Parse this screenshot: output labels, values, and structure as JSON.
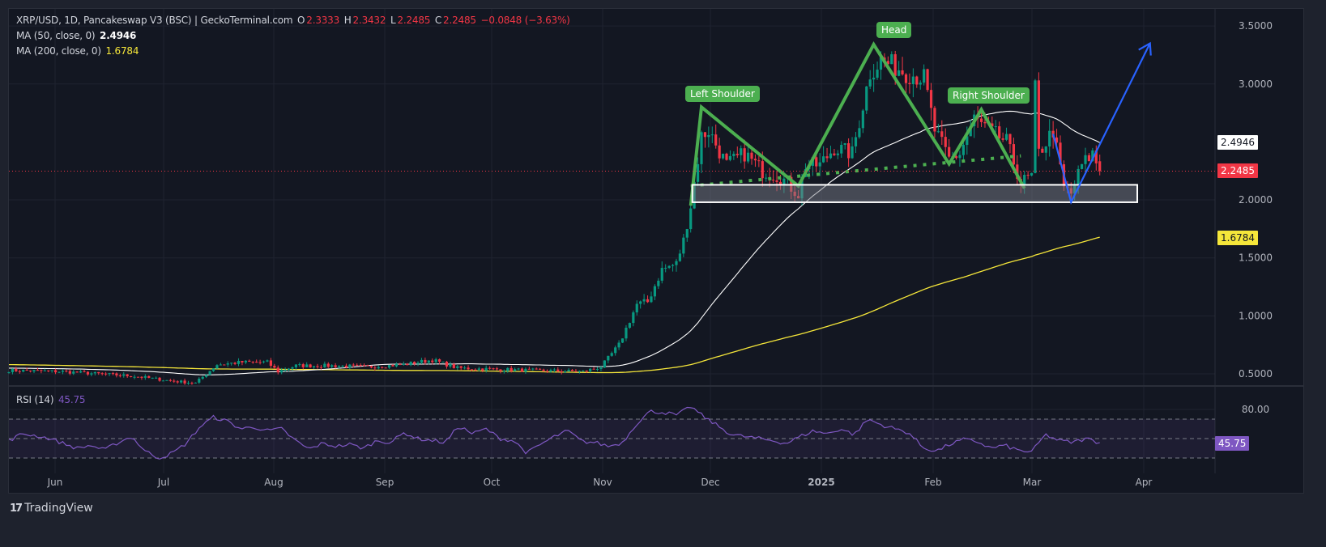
{
  "header": {
    "symbol": "XRP/USD, 1D, Pancakeswap V3 (BSC) | GeckoTerminal.com",
    "open_label": "O",
    "open": "2.3333",
    "high_label": "H",
    "high": "2.3432",
    "low_label": "L",
    "low": "2.2485",
    "close_label": "C",
    "close": "2.2485",
    "change": "−0.0848 (−3.63%)"
  },
  "indicators": {
    "ma50_label": "MA (50, close, 0)",
    "ma50_value": "2.4946",
    "ma200_label": "MA (200, close, 0)",
    "ma200_value": "1.6784",
    "rsi_label": "RSI (14)",
    "rsi_value": "45.75"
  },
  "price_badges": {
    "ma50": "2.4946",
    "last": "2.2485",
    "ma200": "1.6784",
    "rsi": "45.75"
  },
  "pattern_labels": {
    "left_shoulder": "Left Shoulder",
    "head": "Head",
    "right_shoulder": "Right Shoulder"
  },
  "footer": {
    "brand": "TradingView",
    "logo_mark": "17"
  },
  "colors": {
    "up": "#089981",
    "down": "#f23645",
    "ma50": "#ffffff",
    "ma200": "#f5e63a",
    "rsi": "#7e57c2",
    "pattern": "#4caf50",
    "projection": "#2962ff",
    "background": "#131722"
  },
  "chart_data": [
    {
      "type": "candlestick",
      "title": "XRP/USD, 1D, Pancakeswap V3 (BSC)",
      "yaxis": {
        "ticks": [
          "3.5000",
          "3.0000",
          "2.0000",
          "1.5000",
          "1.0000",
          "0.5000"
        ],
        "tick_values": [
          3.5,
          3.0,
          2.0,
          1.5,
          1.0,
          0.5
        ],
        "range": [
          0.38,
          3.7
        ],
        "scale": "linear"
      },
      "xaxis": {
        "ticks": [
          "Jun",
          "Jul",
          "Aug",
          "Sep",
          "Oct",
          "Nov",
          "Dec",
          "2025",
          "Feb",
          "Mar",
          "Apr"
        ]
      },
      "price_path": {
        "description": "approximate daily close anchors (day index from May 20, 2024)",
        "anchors": [
          [
            0,
            0.53
          ],
          [
            15,
            0.52
          ],
          [
            25,
            0.5
          ],
          [
            35,
            0.48
          ],
          [
            45,
            0.44
          ],
          [
            52,
            0.42
          ],
          [
            58,
            0.58
          ],
          [
            65,
            0.6
          ],
          [
            72,
            0.6
          ],
          [
            75,
            0.52
          ],
          [
            80,
            0.57
          ],
          [
            90,
            0.57
          ],
          [
            100,
            0.56
          ],
          [
            105,
            0.57
          ],
          [
            110,
            0.58
          ],
          [
            118,
            0.62
          ],
          [
            125,
            0.55
          ],
          [
            135,
            0.54
          ],
          [
            145,
            0.53
          ],
          [
            160,
            0.52
          ],
          [
            165,
            0.56
          ],
          [
            170,
            0.75
          ],
          [
            175,
            1.1
          ],
          [
            178,
            1.12
          ],
          [
            182,
            1.4
          ],
          [
            186,
            1.45
          ],
          [
            188,
            1.65
          ],
          [
            190,
            1.95
          ],
          [
            193,
            2.55
          ],
          [
            195,
            2.6
          ],
          [
            200,
            2.3
          ],
          [
            205,
            2.4
          ],
          [
            210,
            2.25
          ],
          [
            215,
            2.2
          ],
          [
            220,
            2.05
          ],
          [
            222,
            2.3
          ],
          [
            226,
            2.3
          ],
          [
            230,
            2.45
          ],
          [
            235,
            2.4
          ],
          [
            240,
            3.1
          ],
          [
            243,
            3.2
          ],
          [
            247,
            3.15
          ],
          [
            250,
            3.1
          ],
          [
            255,
            3.05
          ],
          [
            258,
            2.6
          ],
          [
            262,
            2.35
          ],
          [
            265,
            2.4
          ],
          [
            269,
            2.7
          ],
          [
            273,
            2.6
          ],
          [
            278,
            2.5
          ],
          [
            282,
            2.15
          ],
          [
            285,
            2.2
          ],
          [
            286,
            2.95
          ],
          [
            287,
            2.4
          ],
          [
            291,
            2.6
          ],
          [
            294,
            2.1
          ],
          [
            296,
            2.05
          ],
          [
            299,
            2.3
          ],
          [
            302,
            2.4
          ],
          [
            304,
            2.2485
          ]
        ],
        "last_close": 2.2485
      },
      "series": [
        {
          "name": "MA (50, close, 0)",
          "last_value": 2.4946,
          "color": "#ffffff"
        },
        {
          "name": "MA (200, close, 0)",
          "last_value": 1.6784,
          "color": "#f5e63a"
        }
      ],
      "annotations": [
        {
          "type": "label",
          "text": "Left Shoulder",
          "price": 2.85
        },
        {
          "type": "label",
          "text": "Head",
          "price": 3.42
        },
        {
          "type": "label",
          "text": "Right Shoulder",
          "price": 2.85
        },
        {
          "type": "polyline",
          "name": "head-and-shoulders",
          "points": [
            [
              190,
              1.95
            ],
            [
              193,
              2.8
            ],
            [
              220,
              2.12
            ],
            [
              241,
              3.34
            ],
            [
              262,
              2.31
            ],
            [
              271,
              2.78
            ],
            [
              283,
              2.1
            ]
          ]
        },
        {
          "type": "dotted-line",
          "name": "neckline",
          "points": [
            [
              190,
              2.12
            ],
            [
              282,
              2.38
            ]
          ]
        },
        {
          "type": "rectangle",
          "name": "support-zone",
          "price_range": [
            1.98,
            2.13
          ]
        },
        {
          "type": "arrow",
          "name": "projection",
          "points": [
            [
              291,
              2.57
            ],
            [
              296,
              1.98
            ],
            [
              318,
              3.35
            ]
          ]
        },
        {
          "type": "hline",
          "name": "last-price",
          "price": 2.2485
        }
      ]
    },
    {
      "type": "line",
      "title": "RSI (14)",
      "last_value": 45.75,
      "yaxis": {
        "ticks": [
          "80.00"
        ],
        "bands": [
          30,
          50,
          70
        ]
      },
      "values_sample": [
        48,
        55,
        53,
        50,
        45,
        40,
        43,
        38,
        46,
        52,
        37,
        30,
        35,
        45,
        62,
        72,
        68,
        60,
        62,
        58,
        60,
        48,
        39,
        45,
        42,
        44,
        40,
        48,
        46,
        56,
        50,
        48,
        46,
        63,
        55,
        60,
        50,
        48,
        35,
        44,
        52,
        58,
        47,
        46,
        42,
        46,
        65,
        78,
        77,
        74,
        83,
        72,
        63,
        54,
        52,
        50,
        48,
        45,
        52,
        58,
        55,
        60,
        54,
        70,
        64,
        60,
        56,
        41,
        37,
        44,
        49,
        47,
        40,
        43,
        38,
        36,
        54,
        48,
        46,
        50,
        45.75
      ]
    }
  ]
}
